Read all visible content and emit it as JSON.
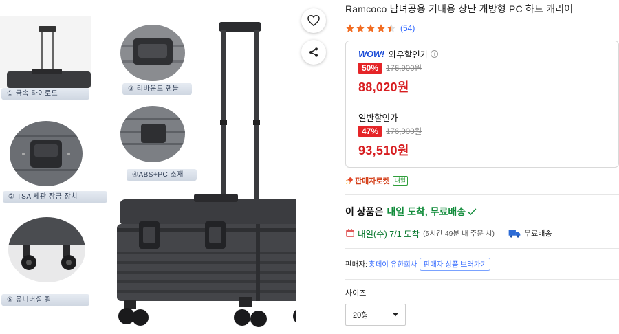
{
  "gallery": {
    "captions": [
      "① 금속 타이로드",
      "③ 리바운드 핸들",
      "② TSA 세관 잠금 장치",
      "④ABS+PC 소재",
      "⑤ 유니버셜 휠"
    ]
  },
  "product": {
    "title": "Ramcoco 남녀공용 기내용 상단 개방형 PC 하드 캐리어",
    "rating": 4.5,
    "review_count": "(54)"
  },
  "prices": {
    "wow": {
      "logo": "WOW!",
      "label": "와우할인가",
      "info_icon": "i",
      "discount": "50%",
      "original": "176,900원",
      "final": "88,020원"
    },
    "regular": {
      "label": "일반할인가",
      "discount": "47%",
      "original": "176,900원",
      "final": "93,510원"
    }
  },
  "rocket": {
    "label": "판매자로켓",
    "badge": "내일"
  },
  "delivery": {
    "headline": "이 상품은",
    "headline_green": "내일 도착, 무료배송",
    "date": "내일(수) 7/1 도착",
    "note": "(5시간 49분 내 주문 시)",
    "shipping": "무료배송"
  },
  "seller": {
    "label": "판매자:",
    "name": "홍페이 유한회사",
    "link": "판매자 상품 보러가기"
  },
  "options": {
    "size_label": "사이즈",
    "size_value": "20형"
  },
  "colors": {
    "accent_red": "#d71d20",
    "badge_red": "#e52528",
    "link_blue": "#346aff",
    "delivery_green": "#128c3b",
    "star_orange": "#f26c21"
  }
}
